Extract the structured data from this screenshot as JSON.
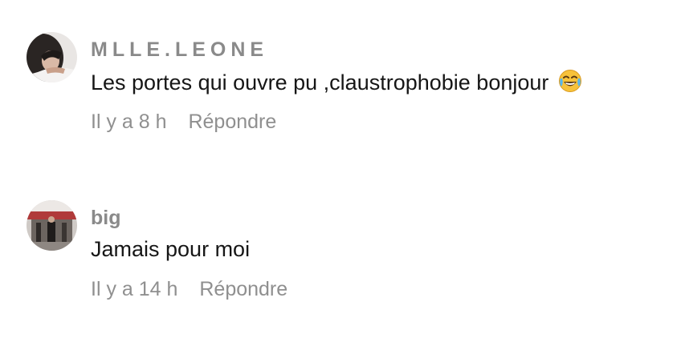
{
  "comments": [
    {
      "username": "MLLE.LEONE",
      "text": "Les portes qui ouvre pu ,claustrophobie bonjour",
      "emoji": "tears-of-joy-emoji",
      "time": "Il y a 8 h",
      "reply_label": "Répondre"
    },
    {
      "username": "big",
      "text": "Jamais pour moi",
      "time": "Il y a 14 h",
      "reply_label": "Répondre"
    }
  ]
}
